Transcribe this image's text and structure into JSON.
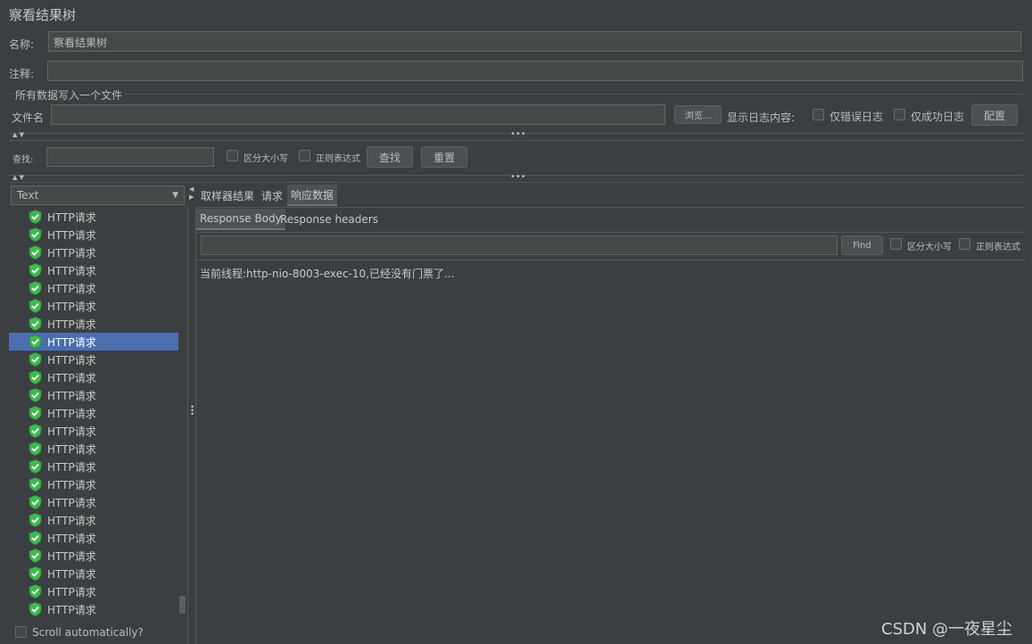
{
  "window_title": "察看结果树",
  "name_label": "名称:",
  "name_value": "察看结果树",
  "comment_label": "注释:",
  "comment_value": "",
  "file_section_title": "所有数据写入一个文件",
  "filename_label": "文件名",
  "filename_value": "",
  "browse_label": "浏览...",
  "log_content_label": "显示日志内容:",
  "errors_only_label": "仅错误日志",
  "success_only_label": "仅成功日志",
  "configure_label": "配置",
  "search": {
    "label": "查找:",
    "value": "",
    "case_sensitive_label": "区分大小写",
    "regex_label": "正则表达式",
    "find_label": "查找",
    "reset_label": "重置"
  },
  "renderer_select": "Text",
  "tree_items": [
    "HTTP请求",
    "HTTP请求",
    "HTTP请求",
    "HTTP请求",
    "HTTP请求",
    "HTTP请求",
    "HTTP请求",
    "HTTP请求",
    "HTTP请求",
    "HTTP请求",
    "HTTP请求",
    "HTTP请求",
    "HTTP请求",
    "HTTP请求",
    "HTTP请求",
    "HTTP请求",
    "HTTP请求",
    "HTTP请求",
    "HTTP请求",
    "HTTP请求",
    "HTTP请求",
    "HTTP请求",
    "HTTP请求"
  ],
  "selected_index": 7,
  "scroll_auto_label": "Scroll automatically?",
  "tabs": [
    "取样器结果",
    "请求",
    "响应数据"
  ],
  "active_tab": 2,
  "subtabs": [
    "Response Body",
    "Response headers"
  ],
  "active_subtab": 0,
  "response_search": {
    "value": "",
    "find_label": "Find",
    "case_sensitive_label": "区分大小写",
    "regex_label": "正则表达式"
  },
  "response_body": "当前线程:http-nio-8003-exec-10,已经没有门票了...",
  "watermark": "CSDN @一夜星尘",
  "colors": {
    "background": "#3c3f41",
    "selection": "#4b6eaf",
    "success_icon": "#3fb950"
  }
}
